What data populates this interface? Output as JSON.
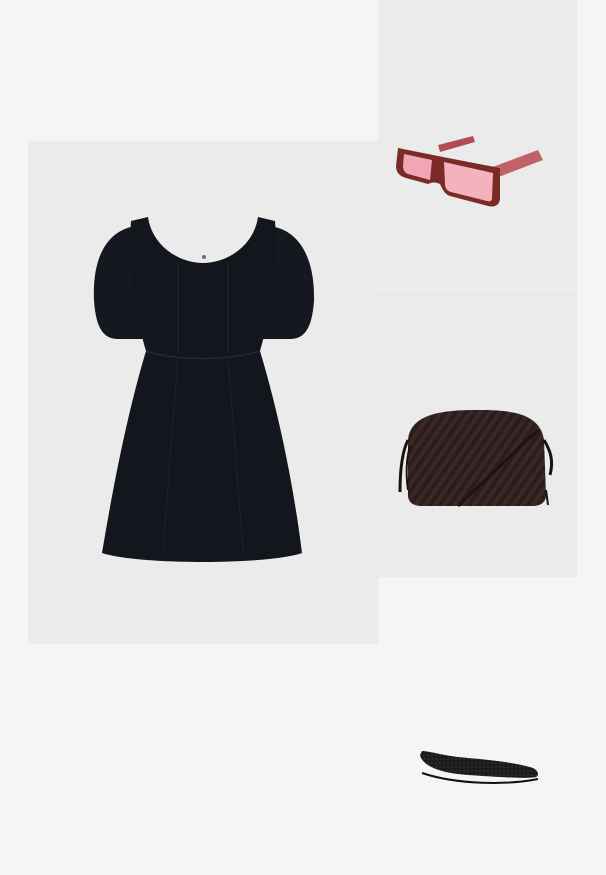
{
  "outfit": {
    "items": [
      {
        "id": "dress",
        "icon": "black-dress-icon",
        "bg": "#ebebeb"
      },
      {
        "id": "sunglasses",
        "icon": "pink-sunglasses-icon",
        "bg": "#ebebeb"
      },
      {
        "id": "bag",
        "icon": "woven-crossbody-bag-icon",
        "bg": "#ebebeb"
      },
      {
        "id": "shoe",
        "icon": "woven-ballet-flat-icon",
        "bg": "#f5f5f5"
      }
    ]
  },
  "colors": {
    "page_bg": "#f5f5f5",
    "panel_bg": "#ebebeb",
    "dress": "#14161e",
    "frame": "#7a2b25",
    "lens": "#f1a6b3",
    "bag": "#2a1d1c",
    "shoe": "#1b1b1b"
  }
}
